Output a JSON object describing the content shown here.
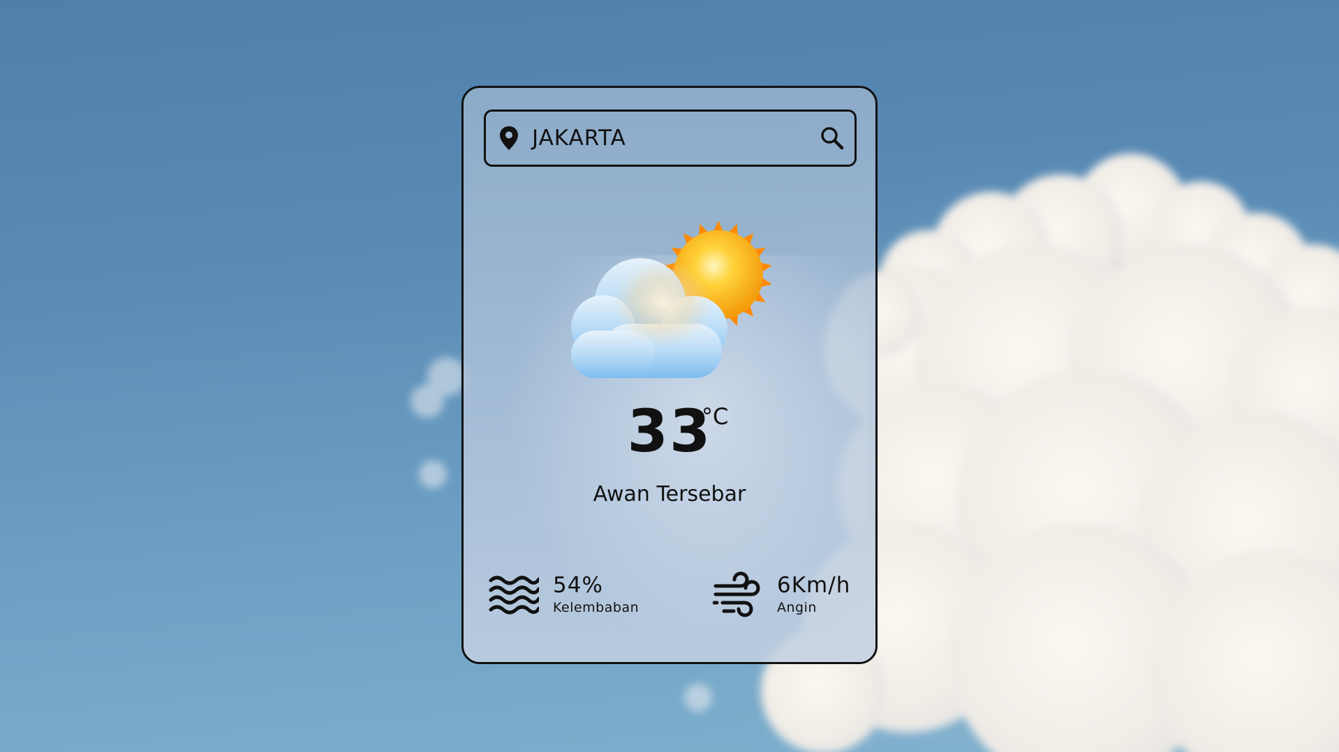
{
  "location": {
    "city": "JAKARTA",
    "pin_icon": "map-pin-icon",
    "search_icon": "magnifier-icon"
  },
  "weather": {
    "icon": "partly-cloudy-icon",
    "temperature": "33",
    "unit": "°C",
    "description": "Awan Tersebar"
  },
  "stats": {
    "humidity": {
      "value": "54%",
      "label": "Kelembaban",
      "icon": "waves-icon"
    },
    "wind": {
      "value": "6Km/h",
      "label": "Angin",
      "icon": "wind-icon"
    }
  },
  "colors": {
    "sky_top": "#4f7fab",
    "sky_bottom": "#7fb0cd",
    "sun": "#f7a20c",
    "sun_rays": "#ff8a00",
    "cloud": "#9fcaf0",
    "text": "#111111"
  }
}
